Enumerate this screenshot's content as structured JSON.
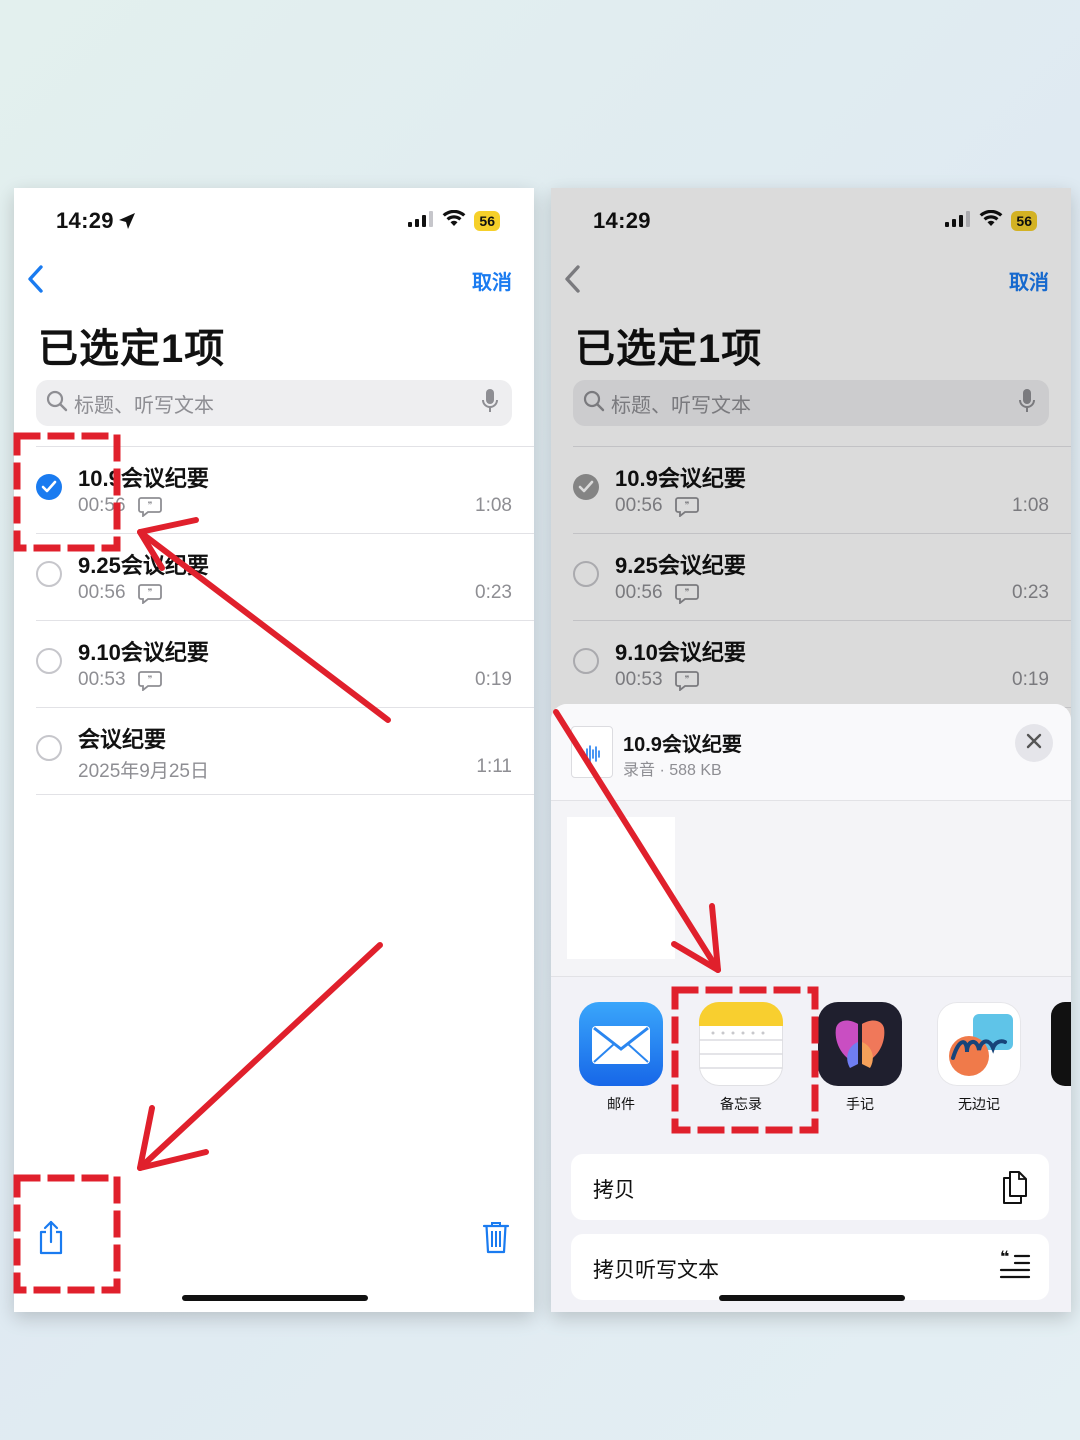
{
  "status": {
    "time": "14:29",
    "battery": "56"
  },
  "nav": {
    "cancel": "取消"
  },
  "page": {
    "title": "已选定1项"
  },
  "search": {
    "placeholder": "标题、听写文本"
  },
  "recordings": [
    {
      "title": "10.9会议纪要",
      "meta": "00:56",
      "duration": "1:08",
      "selected": true
    },
    {
      "title": "9.25会议纪要",
      "meta": "00:56",
      "duration": "0:23",
      "selected": false
    },
    {
      "title": "9.10会议纪要",
      "meta": "00:53",
      "duration": "0:19",
      "selected": false
    },
    {
      "title": "会议纪要",
      "meta": "2025年9月25日",
      "duration": "1:11",
      "selected": false
    }
  ],
  "share": {
    "file_name": "10.9会议纪要",
    "file_meta": "录音 · 588 KB",
    "apps": [
      "邮件",
      "备忘录",
      "手记",
      "无边记"
    ],
    "actions": [
      "拷贝",
      "拷贝听写文本"
    ]
  },
  "colors": {
    "accent": "#1a7bf0",
    "annotation": "#e0202c",
    "battery": "#f6d02a"
  },
  "icons": [
    "location-arrow-icon",
    "cellular-signal-icon",
    "wifi-icon",
    "battery-icon",
    "chevron-left-icon",
    "search-icon",
    "microphone-icon",
    "checkmark-icon",
    "transcript-bubble-icon",
    "share-icon",
    "trash-icon",
    "close-icon",
    "audio-file-icon",
    "mail-icon",
    "notes-icon",
    "journal-icon",
    "freeform-icon",
    "copy-icon",
    "copy-transcript-icon"
  ]
}
